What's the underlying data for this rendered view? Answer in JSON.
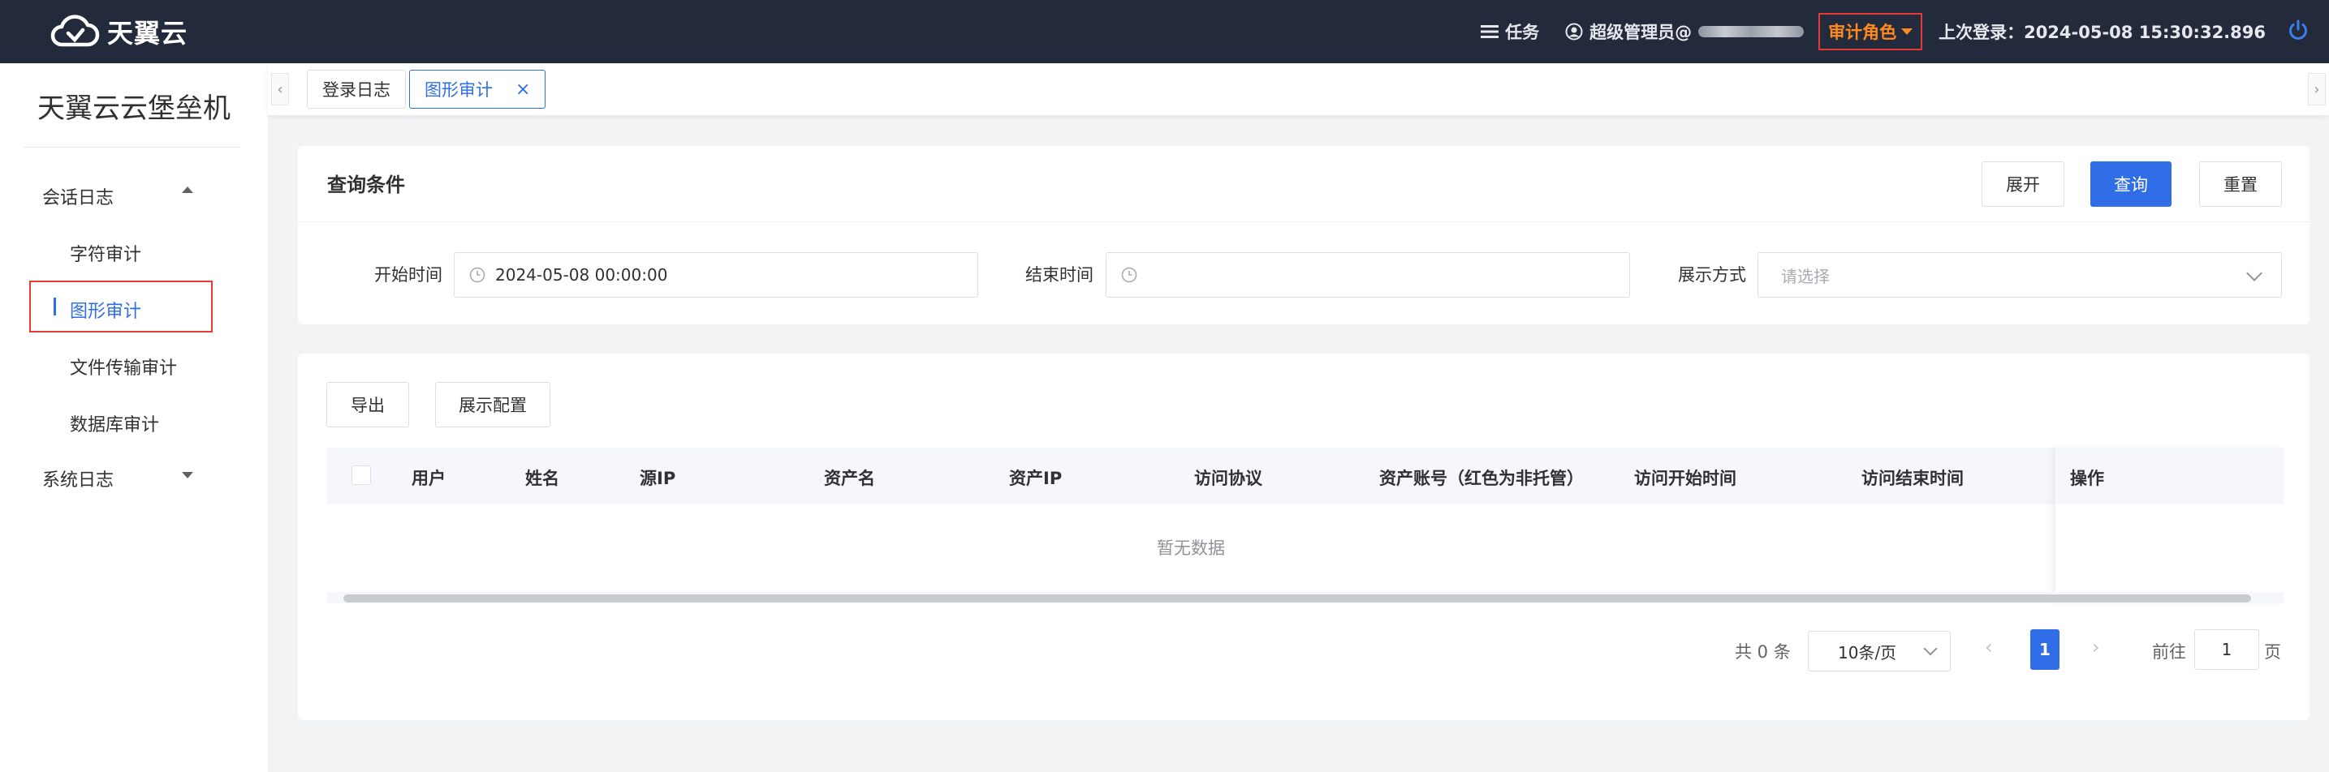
{
  "header": {
    "logo_text": "天翼云",
    "tasks_label": "任务",
    "user_label": "超级管理员@",
    "role_label": "审计角色",
    "last_login": "上次登录：2024-05-08 15:30:32.896"
  },
  "sidebar": {
    "brand": "天翼云云堡垒机",
    "group_session": "会话日志",
    "items": [
      "字符审计",
      "图形审计",
      "文件传输审计",
      "数据库审计"
    ],
    "group_system": "系统日志"
  },
  "tabs": [
    "登录日志",
    "图形审计"
  ],
  "query": {
    "title": "查询条件",
    "expand_label": "展开",
    "search_label": "查询",
    "reset_label": "重置",
    "start_label": "开始时间",
    "start_value": "2024-05-08 00:00:00",
    "end_label": "结束时间",
    "end_value": "",
    "display_label": "展示方式",
    "display_placeholder": "请选择"
  },
  "table": {
    "export_label": "导出",
    "config_label": "展示配置",
    "columns": [
      "用户",
      "姓名",
      "源IP",
      "资产名",
      "资产IP",
      "访问协议",
      "资产账号（红色为非托管）",
      "访问开始时间",
      "访问结束时间"
    ],
    "op_column": "操作",
    "empty_text": "暂无数据"
  },
  "pagination": {
    "total": "共 0 条",
    "page_size": "10条/页",
    "current": "1",
    "goto_label": "前往",
    "goto_value": "1",
    "page_unit": "页"
  },
  "colors": {
    "primary": "#2f6ee6",
    "topbar": "#232a3b",
    "role_text": "#ff8a1f",
    "highlight_border": "#e33b36"
  }
}
